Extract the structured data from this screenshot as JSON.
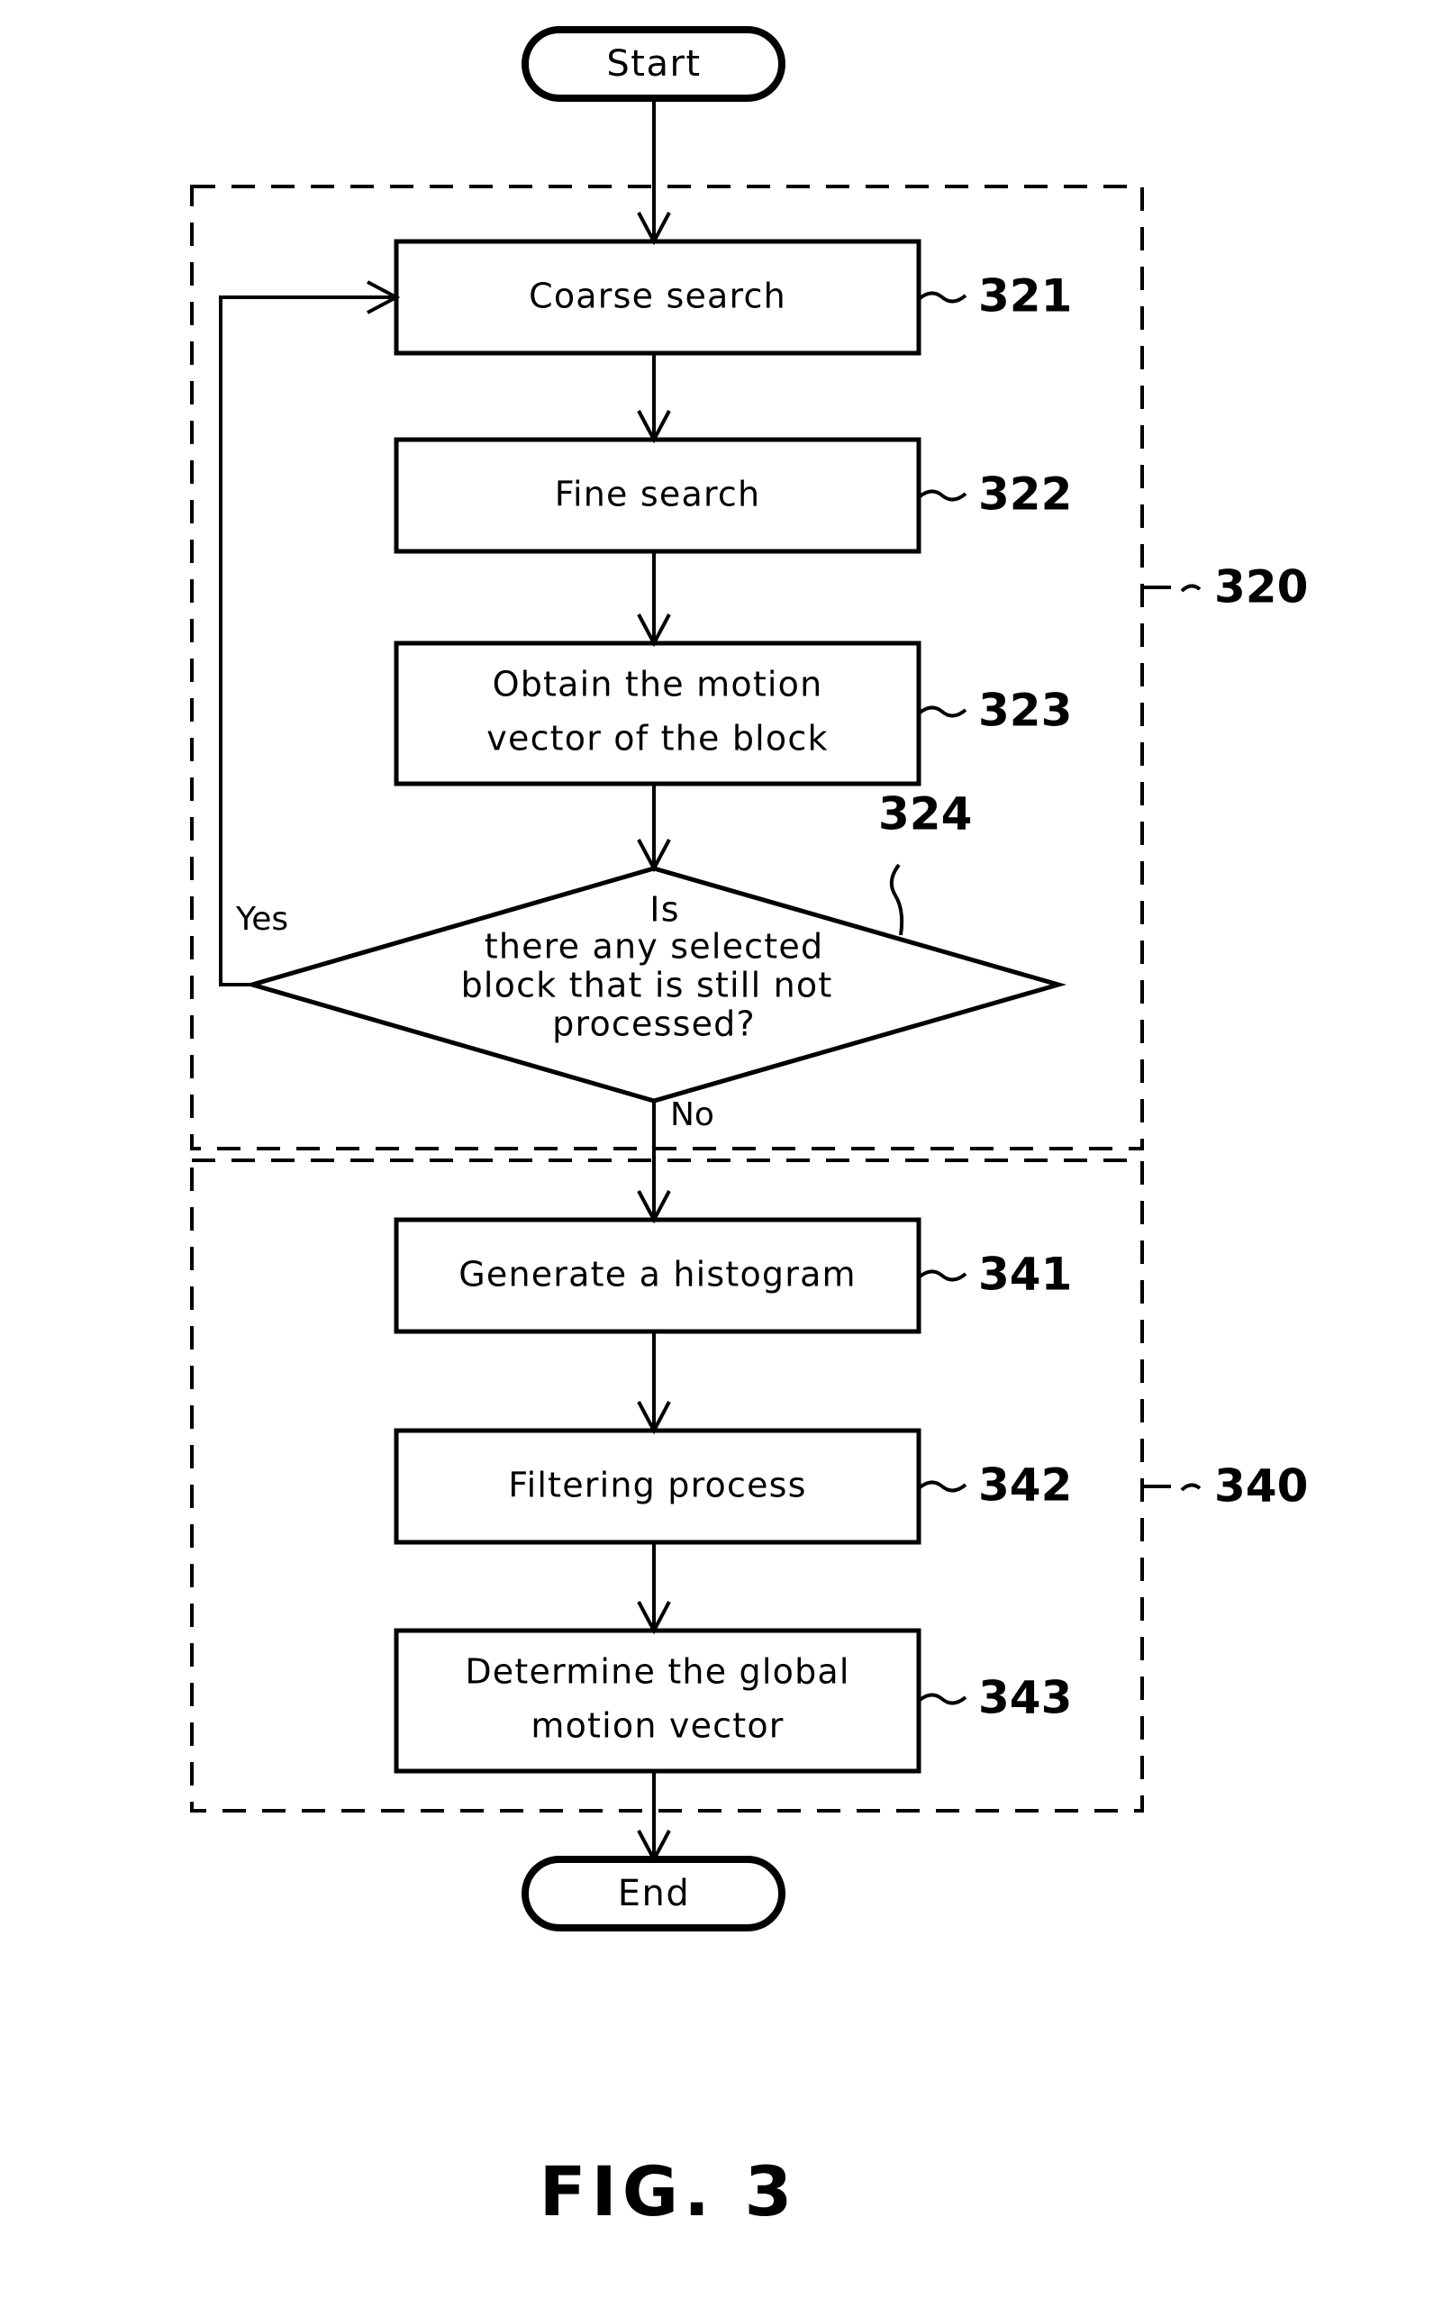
{
  "figure": {
    "caption": "FIG. 3",
    "type": "flowchart"
  },
  "terminators": {
    "start": "Start",
    "end": "End"
  },
  "groups": [
    {
      "ref": "320",
      "member_steps": [
        "321",
        "322",
        "323",
        "324"
      ]
    },
    {
      "ref": "340",
      "member_steps": [
        "341",
        "342",
        "343"
      ]
    }
  ],
  "steps": [
    {
      "ref": "321",
      "shape": "process",
      "label": "Coarse search"
    },
    {
      "ref": "322",
      "shape": "process",
      "label": "Fine search"
    },
    {
      "ref": "323",
      "shape": "process",
      "label_line1": "Obtain the motion",
      "label_line2": "vector of the block"
    },
    {
      "ref": "324",
      "shape": "decision",
      "label_line1": "Is",
      "label_line2": "there any selected",
      "label_line3": "block that is still not",
      "label_line4": "processed?"
    },
    {
      "ref": "341",
      "shape": "process",
      "label": "Generate a histogram"
    },
    {
      "ref": "342",
      "shape": "process",
      "label": "Filtering process"
    },
    {
      "ref": "343",
      "shape": "process",
      "label_line1": "Determine the global",
      "label_line2": "motion vector"
    }
  ],
  "edge_labels": {
    "yes": "Yes",
    "no": "No"
  },
  "colors": {
    "ink": "#000000",
    "paper": "#ffffff"
  }
}
